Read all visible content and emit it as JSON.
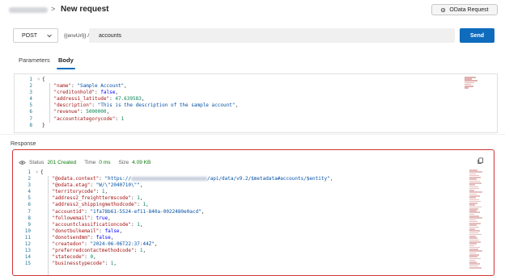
{
  "header": {
    "breadcrumb_sep": ">",
    "title": "New request",
    "odata_button": "OData Request"
  },
  "request": {
    "method": "POST",
    "url_prefix": "{{envUrl}} /",
    "url_value": "accounts",
    "send_label": "Send"
  },
  "tabs": {
    "parameters": "Parameters",
    "body": "Body"
  },
  "body_lines": [
    {
      "n": "1",
      "text": "{"
    },
    {
      "n": "2",
      "key": "\"name\"",
      "val": "\"Sample Account\"",
      "vt": "s"
    },
    {
      "n": "3",
      "key": "\"creditonhold\"",
      "val": "false",
      "vt": "b"
    },
    {
      "n": "4",
      "key": "\"address1_latitude\"",
      "val": "47.639583",
      "vt": "n"
    },
    {
      "n": "5",
      "key": "\"description\"",
      "val": "\"This is the description of the sample account\"",
      "vt": "s"
    },
    {
      "n": "6",
      "key": "\"revenue\"",
      "val": "5000000",
      "vt": "n"
    },
    {
      "n": "7",
      "key": "\"accountcategorycode\"",
      "val": "1",
      "vt": "n",
      "last": true
    },
    {
      "n": "8",
      "text": "}"
    }
  ],
  "response": {
    "section_label": "Response",
    "status_label": "Status",
    "status_value": "201 Created",
    "time_label": "Time",
    "time_value": "0 ms",
    "size_label": "Size",
    "size_value": "4.09 KB",
    "context_suffix": "/api/data/v9.2/$metadata#accounts/$entity\",",
    "lines": [
      {
        "n": "1",
        "text": "{"
      },
      {
        "n": "2",
        "key": "\"@odata.context\"",
        "context": true
      },
      {
        "n": "3",
        "key": "\"@odata.etag\"",
        "val": "\"W/\\\"2040710\\\"\"",
        "vt": "s"
      },
      {
        "n": "4",
        "key": "\"territorycode\"",
        "val": "1",
        "vt": "n"
      },
      {
        "n": "5",
        "key": "\"address2_freighttermscode\"",
        "val": "1",
        "vt": "n"
      },
      {
        "n": "6",
        "key": "\"address2_shippingmethodcode\"",
        "val": "1",
        "vt": "n"
      },
      {
        "n": "7",
        "key": "\"accountid\"",
        "val": "\"1fa78b61-5524-ef11-840a-0022480e0acd\"",
        "vt": "s"
      },
      {
        "n": "8",
        "key": "\"followemail\"",
        "val": "true",
        "vt": "b"
      },
      {
        "n": "9",
        "key": "\"accountclassificationcode\"",
        "val": "1",
        "vt": "n"
      },
      {
        "n": "10",
        "key": "\"donotbulkemail\"",
        "val": "false",
        "vt": "b"
      },
      {
        "n": "11",
        "key": "\"donotsendmm\"",
        "val": "false",
        "vt": "b"
      },
      {
        "n": "12",
        "key": "\"createdon\"",
        "val": "\"2024-06-06T22:37:44Z\"",
        "vt": "s"
      },
      {
        "n": "13",
        "key": "\"preferredcontactmethodcode\"",
        "val": "1",
        "vt": "n"
      },
      {
        "n": "14",
        "key": "\"statecode\"",
        "val": "0",
        "vt": "n"
      },
      {
        "n": "15",
        "key": "\"businesstypecode\"",
        "val": "1",
        "vt": "n"
      }
    ]
  },
  "colors": {
    "accent": "#0f6cbd",
    "success": "#107c10",
    "error_border": "#d13438"
  },
  "icons": {
    "odata": "gear-icon",
    "method_dropdown": "chevron-down-icon",
    "status": "eye-icon",
    "copy": "copy-icon"
  }
}
